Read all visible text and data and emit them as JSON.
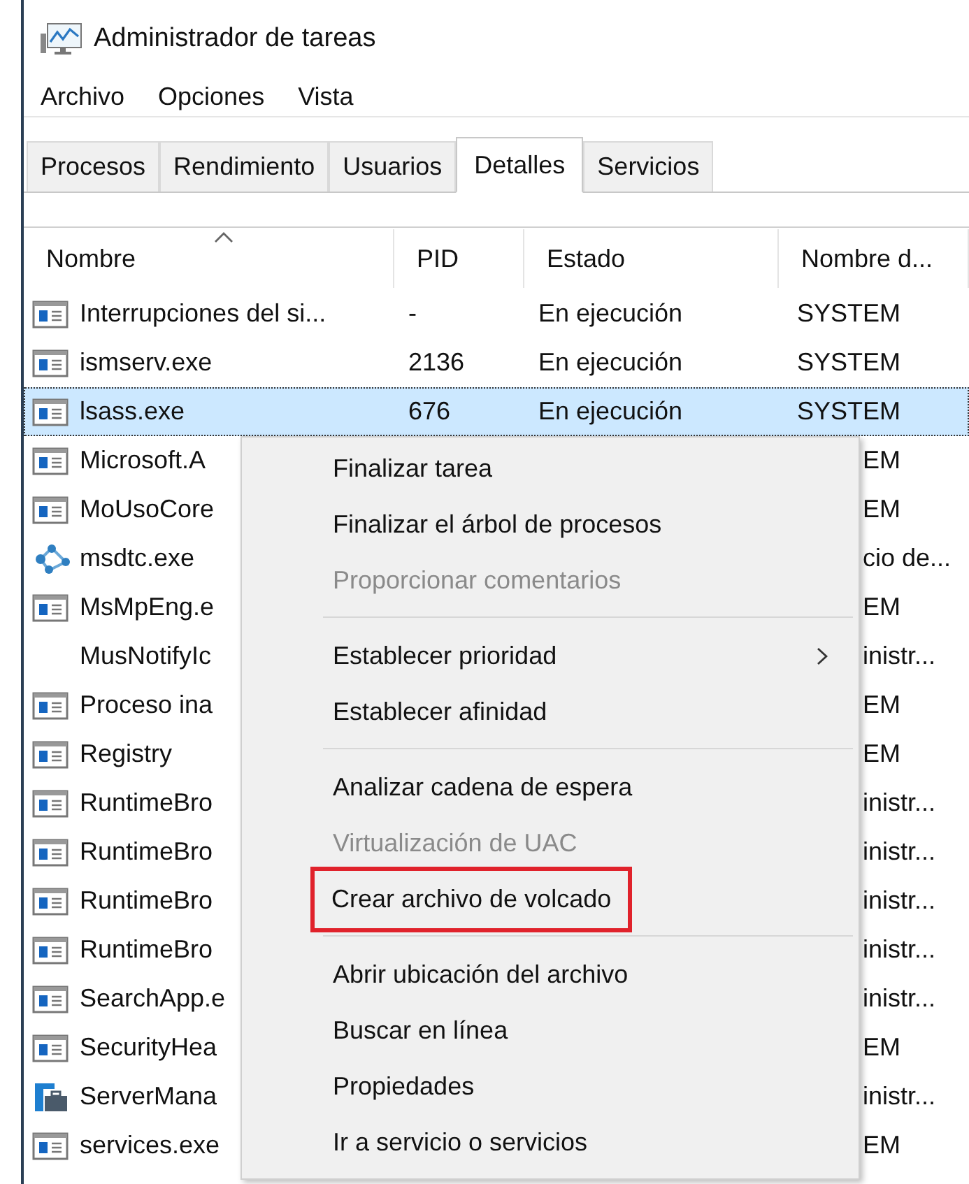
{
  "window": {
    "title": "Administrador de tareas"
  },
  "menu_bar": [
    "Archivo",
    "Opciones",
    "Vista"
  ],
  "tabs": [
    {
      "label": "Procesos",
      "selected": false
    },
    {
      "label": "Rendimiento",
      "selected": false
    },
    {
      "label": "Usuarios",
      "selected": false
    },
    {
      "label": "Detalles",
      "selected": true
    },
    {
      "label": "Servicios",
      "selected": false
    }
  ],
  "table": {
    "columns": [
      "Nombre",
      "PID",
      "Estado",
      "Nombre d..."
    ],
    "rows": [
      {
        "kind": "window",
        "selected": false,
        "name": "Interrupciones del si...",
        "pid": "-",
        "status": "En ejecución",
        "user": "SYSTEM"
      },
      {
        "kind": "window",
        "selected": false,
        "name": "ismserv.exe",
        "pid": "2136",
        "status": "En ejecución",
        "user": "SYSTEM"
      },
      {
        "kind": "window",
        "selected": true,
        "name": "lsass.exe",
        "pid": "676",
        "status": "En ejecución",
        "user": "SYSTEM"
      },
      {
        "kind": "window",
        "selected": false,
        "name": "Microsoft.A",
        "user": "EM"
      },
      {
        "kind": "window",
        "selected": false,
        "name": "MoUsoCore",
        "user": "EM"
      },
      {
        "kind": "network",
        "selected": false,
        "name": "msdtc.exe",
        "user": "cio de..."
      },
      {
        "kind": "window",
        "selected": false,
        "name": "MsMpEng.e",
        "user": "EM"
      },
      {
        "kind": "plain",
        "selected": false,
        "name": "MusNotifyIc",
        "user": "inistr..."
      },
      {
        "kind": "window",
        "selected": false,
        "name": "Proceso ina",
        "user": "EM"
      },
      {
        "kind": "window",
        "selected": false,
        "name": "Registry",
        "user": "EM"
      },
      {
        "kind": "window",
        "selected": false,
        "name": "RuntimeBro",
        "user": "inistr..."
      },
      {
        "kind": "window",
        "selected": false,
        "name": "RuntimeBro",
        "user": "inistr..."
      },
      {
        "kind": "window",
        "selected": false,
        "name": "RuntimeBro",
        "user": "inistr..."
      },
      {
        "kind": "window",
        "selected": false,
        "name": "RuntimeBro",
        "user": "inistr..."
      },
      {
        "kind": "window",
        "selected": false,
        "name": "SearchApp.e",
        "user": "inistr..."
      },
      {
        "kind": "window",
        "selected": false,
        "name": "SecurityHea",
        "user": "EM"
      },
      {
        "kind": "toolbox",
        "selected": false,
        "name": "ServerMana",
        "user": "inistr..."
      },
      {
        "kind": "window",
        "selected": false,
        "name": "services.exe",
        "user": "EM"
      }
    ]
  },
  "context_menu": {
    "groups": [
      [
        {
          "label": "Finalizar tarea",
          "disabled": false,
          "submenu": false,
          "highlighted": false
        },
        {
          "label": "Finalizar el árbol de procesos",
          "disabled": false,
          "submenu": false,
          "highlighted": false
        },
        {
          "label": "Proporcionar comentarios",
          "disabled": true,
          "submenu": false,
          "highlighted": false
        }
      ],
      [
        {
          "label": "Establecer prioridad",
          "disabled": false,
          "submenu": true,
          "highlighted": false
        },
        {
          "label": "Establecer afinidad",
          "disabled": false,
          "submenu": false,
          "highlighted": false
        }
      ],
      [
        {
          "label": "Analizar cadena de espera",
          "disabled": false,
          "submenu": false,
          "highlighted": false
        },
        {
          "label": "Virtualización de UAC",
          "disabled": true,
          "submenu": false,
          "highlighted": false
        },
        {
          "label": "Crear archivo de volcado",
          "disabled": false,
          "submenu": false,
          "highlighted": true
        }
      ],
      [
        {
          "label": "Abrir ubicación del archivo",
          "disabled": false,
          "submenu": false,
          "highlighted": false
        },
        {
          "label": "Buscar en línea",
          "disabled": false,
          "submenu": false,
          "highlighted": false
        },
        {
          "label": "Propiedades",
          "disabled": false,
          "submenu": false,
          "highlighted": false
        },
        {
          "label": "Ir a servicio o servicios",
          "disabled": false,
          "submenu": false,
          "highlighted": false
        }
      ]
    ]
  }
}
